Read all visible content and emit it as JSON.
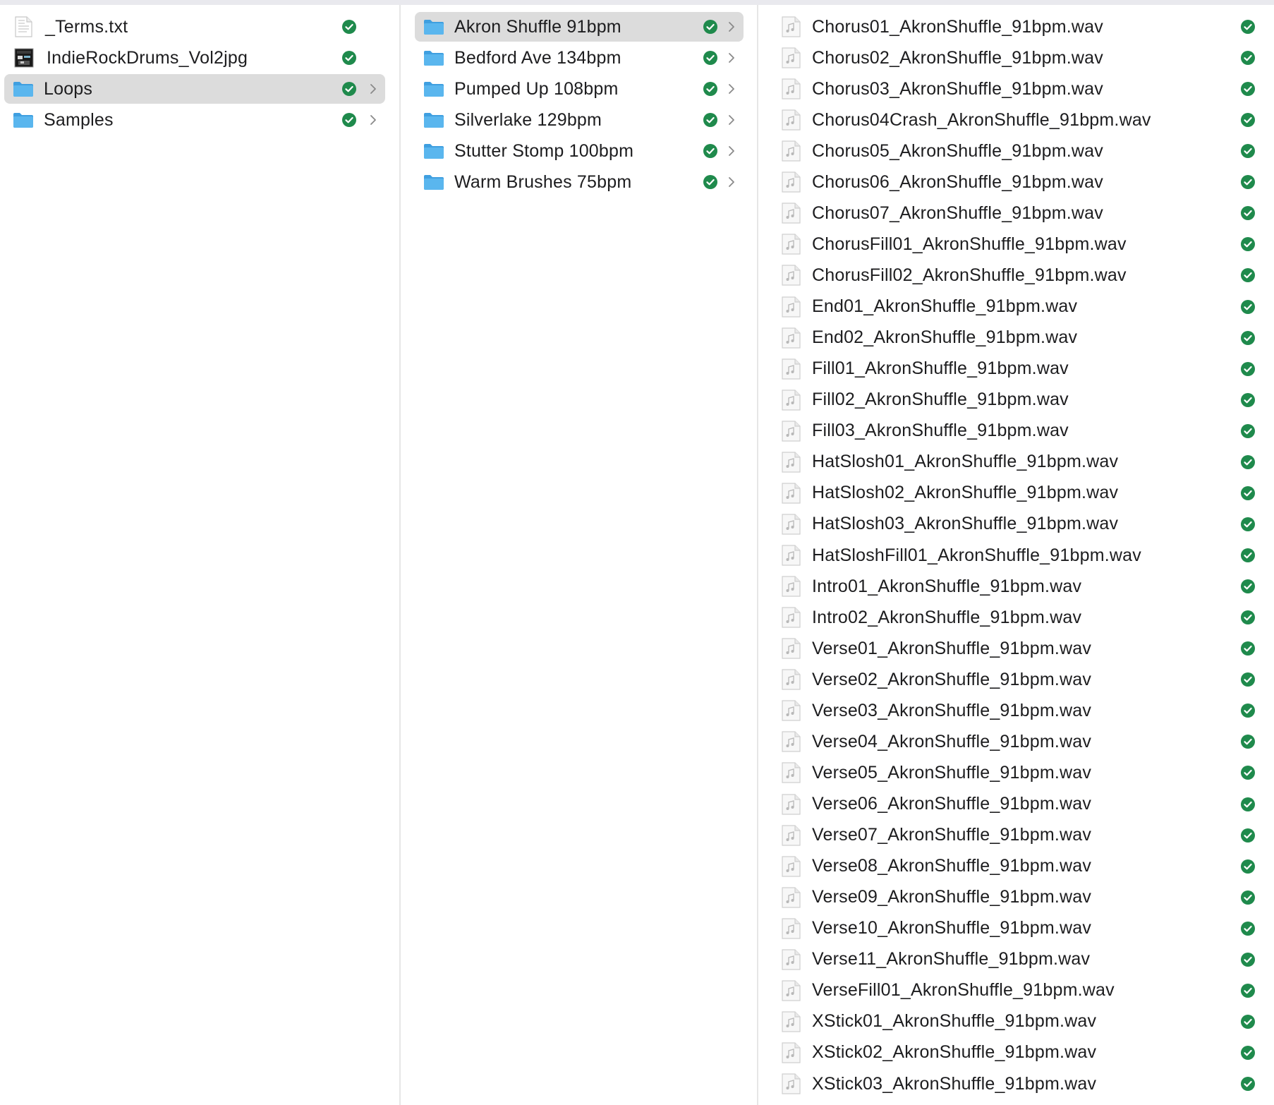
{
  "colors": {
    "accent_folder": "#5ab6ee",
    "status_green": "#1f8a4c",
    "selected_row": "#dcdcdc"
  },
  "columns": {
    "root": {
      "items": [
        {
          "label": "_Terms.txt",
          "icon": "text-file-icon",
          "status": "synced",
          "has_children": false,
          "selected": false
        },
        {
          "label": "IndieRockDrums_Vol2jpg",
          "icon": "image-file-icon",
          "status": "synced",
          "has_children": false,
          "selected": false
        },
        {
          "label": "Loops",
          "icon": "folder-icon",
          "status": "synced",
          "has_children": true,
          "selected": true
        },
        {
          "label": "Samples",
          "icon": "folder-icon",
          "status": "synced",
          "has_children": true,
          "selected": false
        }
      ]
    },
    "loops": {
      "items": [
        {
          "label": "Akron Shuffle 91bpm",
          "icon": "folder-icon",
          "status": "synced",
          "has_children": true,
          "selected": true
        },
        {
          "label": "Bedford Ave 134bpm",
          "icon": "folder-icon",
          "status": "synced",
          "has_children": true,
          "selected": false
        },
        {
          "label": "Pumped Up 108bpm",
          "icon": "folder-icon",
          "status": "synced",
          "has_children": true,
          "selected": false
        },
        {
          "label": "Silverlake 129bpm",
          "icon": "folder-icon",
          "status": "synced",
          "has_children": true,
          "selected": false
        },
        {
          "label": "Stutter Stomp 100bpm",
          "icon": "folder-icon",
          "status": "synced",
          "has_children": true,
          "selected": false
        },
        {
          "label": "Warm Brushes 75bpm",
          "icon": "folder-icon",
          "status": "synced",
          "has_children": true,
          "selected": false
        }
      ]
    },
    "akron_shuffle": {
      "items": [
        {
          "label": "Chorus01_AkronShuffle_91bpm.wav"
        },
        {
          "label": "Chorus02_AkronShuffle_91bpm.wav"
        },
        {
          "label": "Chorus03_AkronShuffle_91bpm.wav"
        },
        {
          "label": "Chorus04Crash_AkronShuffle_91bpm.wav"
        },
        {
          "label": "Chorus05_AkronShuffle_91bpm.wav"
        },
        {
          "label": "Chorus06_AkronShuffle_91bpm.wav"
        },
        {
          "label": "Chorus07_AkronShuffle_91bpm.wav"
        },
        {
          "label": "ChorusFill01_AkronShuffle_91bpm.wav"
        },
        {
          "label": "ChorusFill02_AkronShuffle_91bpm.wav"
        },
        {
          "label": "End01_AkronShuffle_91bpm.wav"
        },
        {
          "label": "End02_AkronShuffle_91bpm.wav"
        },
        {
          "label": "Fill01_AkronShuffle_91bpm.wav"
        },
        {
          "label": "Fill02_AkronShuffle_91bpm.wav"
        },
        {
          "label": "Fill03_AkronShuffle_91bpm.wav"
        },
        {
          "label": "HatSlosh01_AkronShuffle_91bpm.wav"
        },
        {
          "label": "HatSlosh02_AkronShuffle_91bpm.wav"
        },
        {
          "label": "HatSlosh03_AkronShuffle_91bpm.wav"
        },
        {
          "label": "HatSloshFill01_AkronShuffle_91bpm.wav"
        },
        {
          "label": "Intro01_AkronShuffle_91bpm.wav"
        },
        {
          "label": "Intro02_AkronShuffle_91bpm.wav"
        },
        {
          "label": "Verse01_AkronShuffle_91bpm.wav"
        },
        {
          "label": "Verse02_AkronShuffle_91bpm.wav"
        },
        {
          "label": "Verse03_AkronShuffle_91bpm.wav"
        },
        {
          "label": "Verse04_AkronShuffle_91bpm.wav"
        },
        {
          "label": "Verse05_AkronShuffle_91bpm.wav"
        },
        {
          "label": "Verse06_AkronShuffle_91bpm.wav"
        },
        {
          "label": "Verse07_AkronShuffle_91bpm.wav"
        },
        {
          "label": "Verse08_AkronShuffle_91bpm.wav"
        },
        {
          "label": "Verse09_AkronShuffle_91bpm.wav"
        },
        {
          "label": "Verse10_AkronShuffle_91bpm.wav"
        },
        {
          "label": "Verse11_AkronShuffle_91bpm.wav"
        },
        {
          "label": "VerseFill01_AkronShuffle_91bpm.wav"
        },
        {
          "label": "XStick01_AkronShuffle_91bpm.wav"
        },
        {
          "label": "XStick02_AkronShuffle_91bpm.wav"
        },
        {
          "label": "XStick03_AkronShuffle_91bpm.wav"
        }
      ]
    }
  }
}
